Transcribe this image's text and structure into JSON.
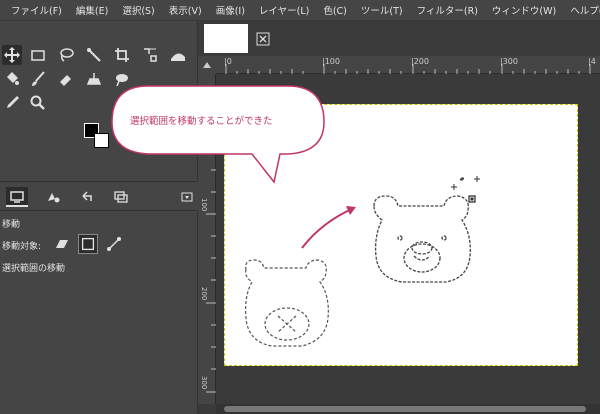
{
  "menu": [
    "ファイル(F)",
    "編集(E)",
    "選択(S)",
    "表示(V)",
    "画像(I)",
    "レイヤー(L)",
    "色(C)",
    "ツール(T)",
    "フィルター(R)",
    "ウィンドウ(W)",
    "ヘルプ(H)"
  ],
  "tool_options": {
    "title": "移動",
    "move_target_label": "移動対象:",
    "mode_label": "選択範囲の移動"
  },
  "ruler": {
    "h": [
      "|0",
      "|100",
      "|200",
      "|300",
      "|4"
    ],
    "v": [
      "100",
      "200",
      "300"
    ]
  },
  "callout": {
    "text": "選択範囲を移動することができた",
    "color": "#c03468"
  },
  "colors": {
    "accent": "#c03468",
    "selection_border": "#c8c800"
  }
}
